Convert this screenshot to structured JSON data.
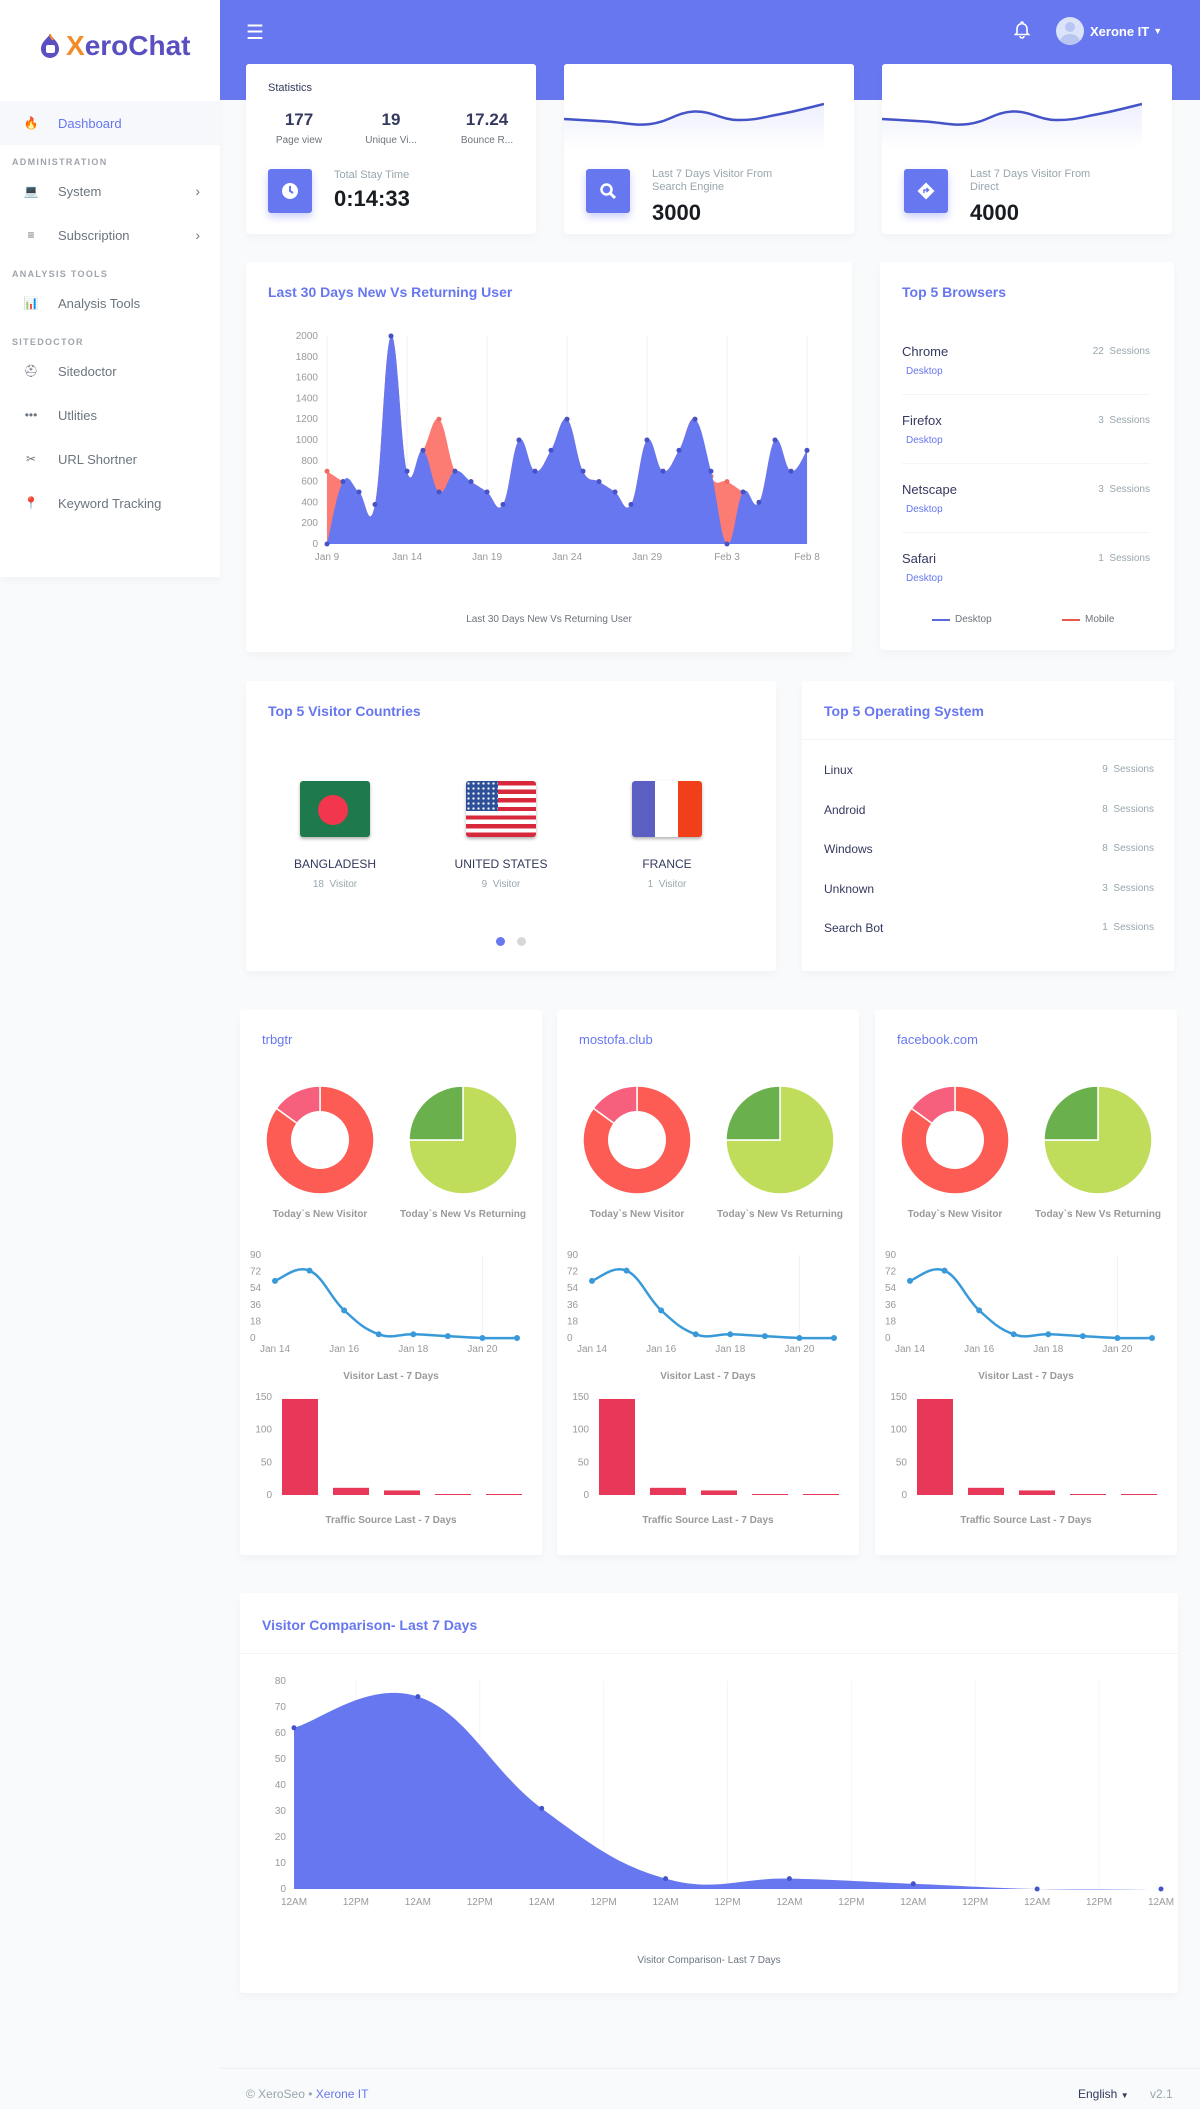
{
  "app": {
    "logo_x": "X",
    "logo_rest": "eroChat",
    "user_name": "Xerone IT",
    "menu_toggle": "☰"
  },
  "sidebar": {
    "items": [
      {
        "label": "Dashboard",
        "icon": "fire-icon",
        "glyph": "🔥",
        "active": true
      },
      {
        "header": "ADMINISTRATION"
      },
      {
        "label": "System",
        "icon": "laptop-icon",
        "glyph": "💻",
        "chevron": true
      },
      {
        "label": "Subscription",
        "icon": "coins-icon",
        "glyph": "≡",
        "chevron": true
      },
      {
        "header": "ANALYSIS TOOLS"
      },
      {
        "label": "Analysis Tools",
        "icon": "chart-icon",
        "glyph": "📊"
      },
      {
        "header": "SITEDOCTOR"
      },
      {
        "label": "Sitedoctor",
        "icon": "medkit-icon",
        "glyph": "⛑"
      },
      {
        "label": "Utlities",
        "icon": "ellipsis-icon",
        "glyph": "•••"
      },
      {
        "label": "URL Shortner",
        "icon": "cut-icon",
        "glyph": "✂"
      },
      {
        "label": "Keyword Tracking",
        "icon": "map-marker-icon",
        "glyph": "📍"
      }
    ]
  },
  "statistics": {
    "title": "Statistics",
    "page_view": {
      "value": "177",
      "label": "Page view"
    },
    "unique_visitor": {
      "value": "19",
      "label": "Unique Vi..."
    },
    "bounce_rate": {
      "value": "17.24",
      "label": "Bounce R..."
    },
    "stay_time": {
      "label": "Total Stay Time",
      "value": "0:14:33"
    }
  },
  "search_engine": {
    "label_line1": "Last 7 Days Visitor From",
    "label_line2": "Search Engine",
    "value": "3000",
    "sparkline": [
      40,
      35,
      30,
      55,
      38,
      50,
      70
    ]
  },
  "direct": {
    "label_line1": "Last 7 Days Visitor From",
    "label_line2": "Direct",
    "value": "4000",
    "sparkline": [
      40,
      35,
      30,
      55,
      38,
      50,
      70
    ]
  },
  "new_vs_returning": {
    "title": "Last 30 Days New Vs Returning User",
    "caption": "Last 30 Days New Vs Returning User"
  },
  "browsers": {
    "title": "Top 5 Browsers",
    "items": [
      {
        "name": "Chrome",
        "type": "Desktop",
        "sessions": "22",
        "unit": "Sessions"
      },
      {
        "name": "Firefox",
        "type": "Desktop",
        "sessions": "3",
        "unit": "Sessions"
      },
      {
        "name": "Netscape",
        "type": "Desktop",
        "sessions": "3",
        "unit": "Sessions"
      },
      {
        "name": "Safari",
        "type": "Desktop",
        "sessions": "1",
        "unit": "Sessions"
      }
    ],
    "legend": [
      {
        "label": "Desktop",
        "color": "#5a6ad6"
      },
      {
        "label": "Mobile",
        "color": "#e5584a"
      }
    ]
  },
  "countries": {
    "title": "Top 5 Visitor Countries",
    "items": [
      {
        "name": "BANGLADESH",
        "visitors": "18",
        "unit": "Visitor",
        "flag": "bd"
      },
      {
        "name": "UNITED STATES",
        "visitors": "9",
        "unit": "Visitor",
        "flag": "us"
      },
      {
        "name": "FRANCE",
        "visitors": "1",
        "unit": "Visitor",
        "flag": "fr"
      }
    ],
    "carousel_pages": 2,
    "active_page": 1
  },
  "os": {
    "title": "Top 5 Operating System",
    "items": [
      {
        "name": "Linux",
        "sessions": "9",
        "unit": "Sessions"
      },
      {
        "name": "Android",
        "sessions": "8",
        "unit": "Sessions"
      },
      {
        "name": "Windows",
        "sessions": "8",
        "unit": "Sessions"
      },
      {
        "name": "Unknown",
        "sessions": "3",
        "unit": "Sessions"
      },
      {
        "name": "Search Bot",
        "sessions": "1",
        "unit": "Sessions"
      }
    ]
  },
  "sites": [
    {
      "name": "trbgtr",
      "donut_caption": "Today`s New Visitor",
      "pie_caption": "Today`s New Vs Returning",
      "line_caption": "Visitor Last - 7 Days",
      "bar_caption": "Traffic Source Last - 7 Days"
    },
    {
      "name": "mostofa.club",
      "donut_caption": "Today`s New Visitor",
      "pie_caption": "Today`s New Vs Returning",
      "line_caption": "Visitor Last - 7 Days",
      "bar_caption": "Traffic Source Last - 7 Days"
    },
    {
      "name": "facebook.com",
      "donut_caption": "Today`s New Visitor",
      "pie_caption": "Today`s New Vs Returning",
      "line_caption": "Visitor Last - 7 Days",
      "bar_caption": "Traffic Source Last - 7 Days"
    }
  ],
  "visitor_comparison": {
    "title": "Visitor Comparison- Last 7 Days",
    "caption": "Visitor Comparison- Last 7 Days"
  },
  "footer": {
    "copyright": "© XeroSeo",
    "separator": "•",
    "company": "Xerone IT",
    "language": "English",
    "version": "v2.1"
  },
  "colors": {
    "primary": "#6777ef",
    "returning": "#fc7c74",
    "donut_main": "#fc5c54",
    "donut_secondary": "#f7607d",
    "pie_light": "#bfdc5a",
    "pie_dark": "#6ab04c",
    "line_blue": "#3a9ad9",
    "bar_red": "#e8385a"
  },
  "chart_data": [
    {
      "id": "new-vs-returning",
      "type": "area",
      "title": "Last 30 Days New Vs Returning User",
      "xlabel": "Last 30 Days New Vs Returning User",
      "ylabel": "",
      "ylim": [
        0,
        2000
      ],
      "yticks": [
        0,
        200,
        400,
        600,
        800,
        1000,
        1200,
        1400,
        1600,
        1800,
        2000
      ],
      "xticks": [
        "Jan 9",
        "Jan 14",
        "Jan 19",
        "Jan 24",
        "Jan 29",
        "Feb 3",
        "Feb 8"
      ],
      "x_count": 31,
      "series": [
        {
          "name": "New",
          "color": "#6777ef",
          "values": [
            0,
            600,
            500,
            380,
            2000,
            700,
            900,
            500,
            700,
            600,
            500,
            380,
            1000,
            700,
            900,
            1200,
            700,
            600,
            500,
            380,
            1000,
            700,
            900,
            1200,
            700,
            0,
            500,
            400,
            1000,
            700,
            900
          ]
        },
        {
          "name": "Returning",
          "color": "#fc7c74",
          "values": [
            700,
            600,
            500,
            380,
            2000,
            700,
            900,
            1200,
            700,
            600,
            500,
            380,
            1000,
            700,
            900,
            1200,
            700,
            600,
            500,
            380,
            1000,
            700,
            900,
            1200,
            650,
            600,
            500,
            400,
            1000,
            700,
            900
          ]
        }
      ]
    },
    {
      "id": "site-visitor-line",
      "type": "line",
      "title": "Visitor Last - 7 Days",
      "x": [
        "Jan 14",
        "Jan 15",
        "Jan 16",
        "Jan 17",
        "Jan 18",
        "Jan 19",
        "Jan 20",
        "Jan 21"
      ],
      "xticks": [
        "Jan 14",
        "Jan 16",
        "Jan 18",
        "Jan 20"
      ],
      "yticks": [
        0,
        18,
        36,
        54,
        72,
        90
      ],
      "ylim": [
        0,
        90
      ],
      "values": [
        62,
        73,
        30,
        4,
        4,
        2,
        0,
        0
      ]
    },
    {
      "id": "site-traffic-bar",
      "type": "bar",
      "title": "Traffic Source Last - 7 Days",
      "categories": [
        "1",
        "2",
        "3",
        "4",
        "5"
      ],
      "values": [
        147,
        11,
        7,
        1,
        1
      ],
      "yticks": [
        0,
        50,
        100,
        150
      ],
      "ylim": [
        0,
        150
      ]
    },
    {
      "id": "site-new-visitor-donut",
      "type": "pie",
      "title": "Today`s New Visitor",
      "values": [
        85,
        15
      ]
    },
    {
      "id": "site-new-vs-returning-pie",
      "type": "pie",
      "title": "Today`s New Vs Returning",
      "values": [
        75,
        25
      ]
    },
    {
      "id": "visitor-comparison",
      "type": "area",
      "title": "Visitor Comparison- Last 7 Days",
      "xlabel": "Visitor Comparison- Last 7 Days",
      "ylim": [
        0,
        80
      ],
      "yticks": [
        0,
        10,
        20,
        30,
        40,
        50,
        60,
        70,
        80
      ],
      "xticks": [
        "12AM",
        "12PM",
        "12AM",
        "12PM",
        "12AM",
        "12PM",
        "12AM",
        "12PM",
        "12AM",
        "12PM",
        "12AM",
        "12PM",
        "12AM",
        "12PM",
        "12AM"
      ],
      "values": [
        62,
        74,
        31,
        4,
        4,
        2,
        0,
        0
      ]
    }
  ]
}
